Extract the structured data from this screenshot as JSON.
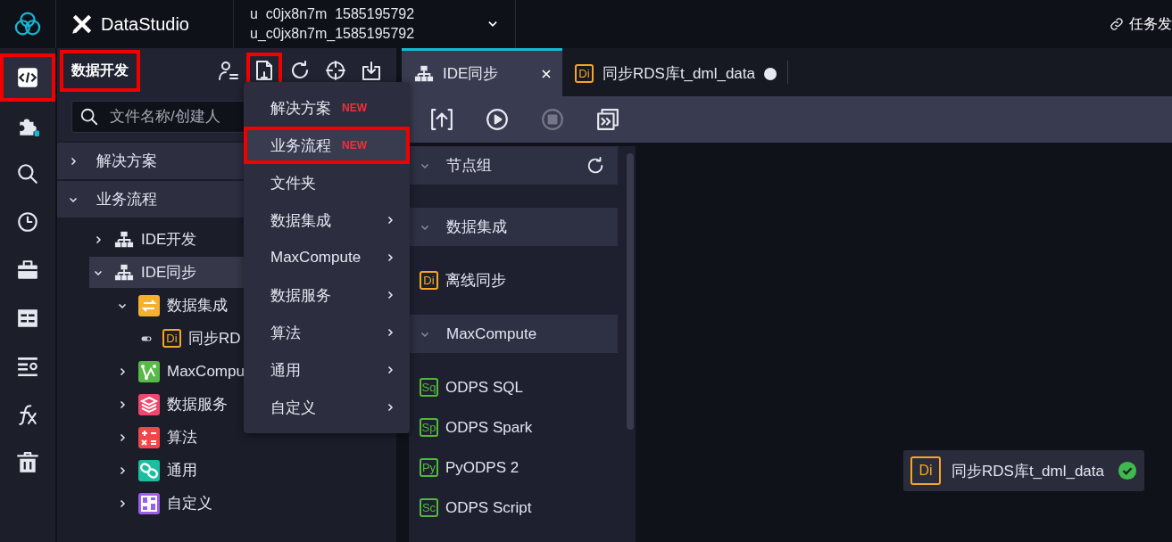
{
  "topbar": {
    "app_name": "DataStudio",
    "project_lines": [
      "u  c0jx8n7m  1585195792",
      "u_c0jx8n7m_1585195792"
    ],
    "right_link": "任务发"
  },
  "rail": [
    {
      "kind": "code",
      "selected": true,
      "highlighted": true
    },
    {
      "kind": "puzzle",
      "selected": false,
      "highlighted": false
    },
    {
      "kind": "search",
      "selected": false,
      "highlighted": false
    },
    {
      "kind": "clock",
      "selected": false,
      "highlighted": false
    },
    {
      "kind": "briefcase",
      "selected": false,
      "highlighted": false
    },
    {
      "kind": "table",
      "selected": false,
      "highlighted": false
    },
    {
      "kind": "list",
      "selected": false,
      "highlighted": false
    },
    {
      "kind": "fx",
      "selected": false,
      "highlighted": false
    },
    {
      "kind": "trash",
      "selected": false,
      "highlighted": false
    }
  ],
  "sidebar": {
    "title": "数据开发",
    "title_highlighted": true,
    "tools": [
      {
        "kind": "user",
        "highlighted": false
      },
      {
        "kind": "new-file",
        "highlighted": true
      },
      {
        "kind": "refresh",
        "highlighted": false
      },
      {
        "kind": "locate",
        "highlighted": false
      },
      {
        "kind": "import",
        "highlighted": false
      }
    ],
    "search": {
      "placeholder": "文件名称/创建人"
    },
    "sections": [
      {
        "label": "解决方案",
        "expanded": false
      },
      {
        "label": "业务流程",
        "expanded": true,
        "children": [
          {
            "label": "IDE开发",
            "kind": "flow",
            "expanded": false,
            "selected": false
          },
          {
            "label": "IDE同步",
            "kind": "flow",
            "expanded": true,
            "selected": true,
            "children": [
              {
                "label": "数据集成",
                "kind": "integration",
                "color": "#f5b12e",
                "expanded": true,
                "selected": false,
                "children": [
                  {
                    "label": "同步RD",
                    "kind": "file",
                    "badge": "Di",
                    "color": "#f5a623",
                    "selected": false
                  }
                ]
              },
              {
                "label": "MaxCompu",
                "kind": "maxcompute",
                "color": "#58b848",
                "expanded": false,
                "selected": false
              },
              {
                "label": "数据服务",
                "kind": "service",
                "color": "#f0476c",
                "expanded": false,
                "selected": false
              },
              {
                "label": "算法",
                "kind": "algorithm",
                "color": "#f04848",
                "expanded": false,
                "selected": false
              },
              {
                "label": "通用",
                "kind": "general",
                "color": "#1bbfa0",
                "expanded": false,
                "selected": false
              },
              {
                "label": "自定义",
                "kind": "custom",
                "color": "#9b5cf0",
                "expanded": false,
                "selected": false
              }
            ]
          }
        ]
      }
    ]
  },
  "new_menu": {
    "items": [
      {
        "label": "解决方案",
        "badge": "NEW",
        "submenu": false,
        "hovered": false,
        "highlighted": false
      },
      {
        "label": "业务流程",
        "badge": "NEW",
        "submenu": false,
        "hovered": true,
        "highlighted": true
      },
      {
        "label": "文件夹",
        "submenu": false,
        "hovered": false,
        "highlighted": false
      },
      {
        "label": "数据集成",
        "submenu": true,
        "hovered": false,
        "highlighted": false
      },
      {
        "label": "MaxCompute",
        "submenu": true,
        "hovered": false,
        "highlighted": false
      },
      {
        "label": "数据服务",
        "submenu": true,
        "hovered": false,
        "highlighted": false
      },
      {
        "label": "算法",
        "submenu": true,
        "hovered": false,
        "highlighted": false
      },
      {
        "label": "通用",
        "submenu": true,
        "hovered": false,
        "highlighted": false
      },
      {
        "label": "自定义",
        "submenu": true,
        "hovered": false,
        "highlighted": false
      }
    ]
  },
  "tabs": [
    {
      "label": "IDE同步",
      "kind": "flow",
      "selected": true,
      "closable": true,
      "unsaved": false
    },
    {
      "label": "同步RDS库t_dml_data",
      "kind": "file",
      "badge": "Di",
      "color": "#f5a623",
      "selected": false,
      "closable": false,
      "unsaved": true
    }
  ],
  "toolbar": [
    {
      "kind": "submit",
      "disabled": false
    },
    {
      "kind": "run",
      "disabled": false
    },
    {
      "kind": "stop",
      "disabled": true
    },
    {
      "kind": "forward",
      "disabled": false
    }
  ],
  "node_panel": {
    "groups": [
      {
        "label": "节点组",
        "expanded": true,
        "refresh": true
      },
      {
        "label": "数据集成",
        "expanded": true,
        "refresh": false,
        "items": [
          {
            "label": "离线同步",
            "badge": "Di",
            "color": "#f5a623"
          }
        ]
      },
      {
        "label": "MaxCompute",
        "expanded": true,
        "refresh": false,
        "items": [
          {
            "label": "ODPS SQL",
            "badge": "Sq",
            "color": "#52b83a"
          },
          {
            "label": "ODPS Spark",
            "badge": "Sp",
            "color": "#52b83a"
          },
          {
            "label": "PyODPS 2",
            "badge": "Py",
            "color": "#52b83a"
          },
          {
            "label": "ODPS Script",
            "badge": "Sc",
            "color": "#52b83a"
          }
        ]
      }
    ]
  },
  "canvas": {
    "nodes": [
      {
        "label": "同步RDS库t_dml_data",
        "badge": "Di",
        "color": "#f5a623",
        "succeeded": true
      }
    ]
  }
}
